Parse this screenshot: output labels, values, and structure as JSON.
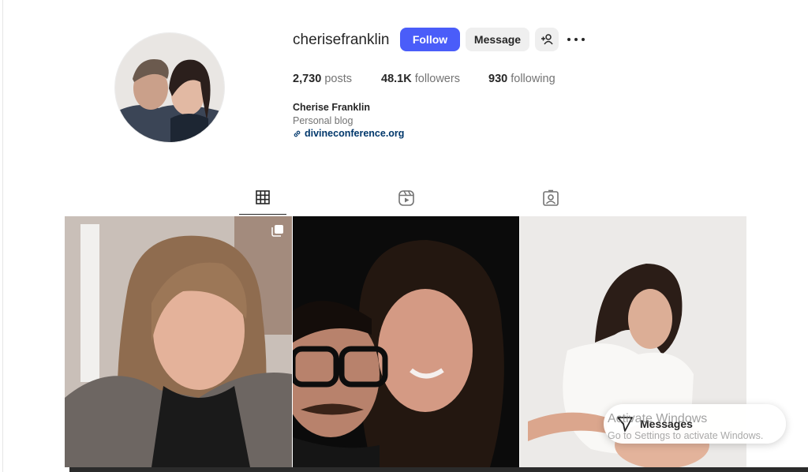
{
  "profile": {
    "username": "cherisefranklin",
    "follow_label": "Follow",
    "message_label": "Message",
    "stats": {
      "posts_count": "2,730",
      "posts_label": "posts",
      "followers_count": "48.1K",
      "followers_label": "followers",
      "following_count": "930",
      "following_label": "following"
    },
    "full_name": "Cherise Franklin",
    "category": "Personal blog",
    "website": "divineconference.org"
  },
  "tabs": [
    {
      "icon": "grid-icon",
      "active": true
    },
    {
      "icon": "reels-icon",
      "active": false
    },
    {
      "icon": "tagged-icon",
      "active": false
    }
  ],
  "messages_label": "Messages",
  "watermark": {
    "line1": "Activate Windows",
    "line2": "Go to Settings to activate Windows."
  },
  "colors": {
    "follow_button": "#4a5df9",
    "link": "#00376b",
    "secondary_button": "#efefef"
  }
}
